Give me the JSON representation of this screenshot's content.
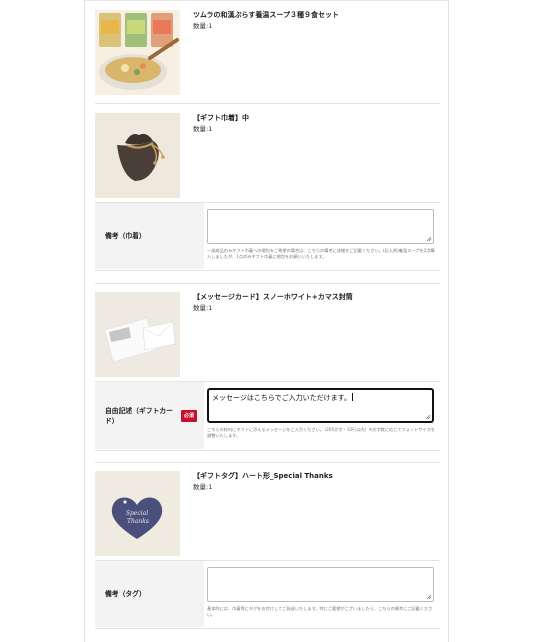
{
  "products": [
    {
      "name": "ツムラの和漢ぷらす養温スープ３種９食セット",
      "qty": "数量:1",
      "image": "soup-set-photo"
    },
    {
      "name": "【ギフト巾着】中",
      "qty": "数量:1",
      "image": "gift-pouch-photo"
    },
    {
      "name": "【メッセージカード】スノーホワイト+カマス封筒",
      "qty": "数量:1",
      "image": "message-card-photo"
    },
    {
      "name": "【ギフトタグ】ハート形_Special Thanks",
      "qty": "数量:1",
      "image": "heart-tag-photo",
      "tag_text": [
        "Special",
        "Thanks"
      ]
    }
  ],
  "fields": [
    {
      "label": "備考（巾着）",
      "value": "",
      "note": "一部商品のみギフト巾着への梱包をご希望の場合は、こちらの備考に詳細をご記載ください。(記入例)養温スープを2点購入しましたが、1点のみギフト巾着に梱包をお願いいたします。"
    },
    {
      "label": "自由記述（ギフトカード）",
      "required": "必須",
      "value": "メッセージはこちらでご入力いただけます。",
      "note": "こちらの枠内にギフトに添えるメッセージをご入力ください。（200文字・10行以内）※文字数に応じてフォントサイズを調整いたします。"
    },
    {
      "label": "備考（タグ）",
      "value": "",
      "note": "基本的には、巾着等にタグをお付けしてご発送いたします。特にご要望がございましたら、こちらの備考にご記載ください。"
    }
  ],
  "colors": {
    "required_badge": "#c8102e",
    "label_bg": "#f3f3f3",
    "tag_heart": "#4a4f7c"
  }
}
